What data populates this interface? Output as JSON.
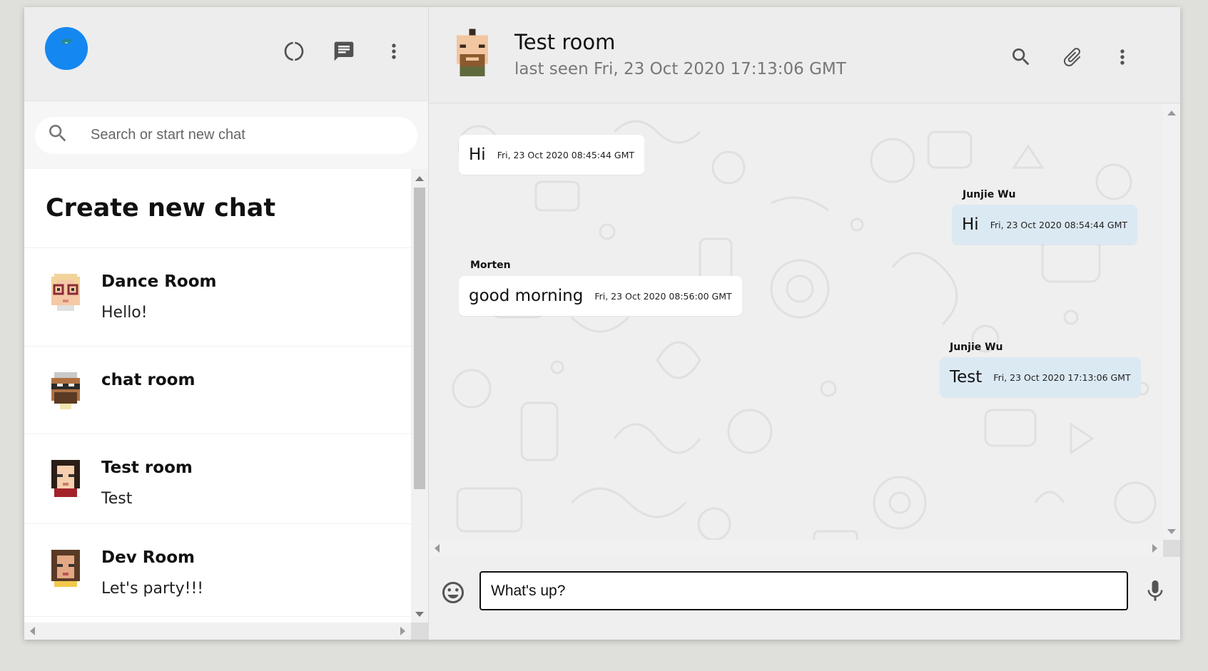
{
  "sidebar": {
    "search_placeholder": "Search or start new chat",
    "create_new_chat": "Create new chat",
    "chats": [
      {
        "name": "Dance Room",
        "last_message": "Hello!",
        "avatar": "pixel-avatar-glasses-blonde"
      },
      {
        "name": "chat room",
        "last_message": "",
        "avatar": "pixel-avatar-glasses-beard"
      },
      {
        "name": "Test room",
        "last_message": "Test",
        "avatar": "pixel-avatar-dark-hair"
      },
      {
        "name": "Dev Room",
        "last_message": "Let's party!!!",
        "avatar": "pixel-avatar-curly-hair"
      }
    ]
  },
  "chat": {
    "title": "Test room",
    "subtitle": "last seen Fri, 23 Oct 2020 17:13:06 GMT",
    "messages": [
      {
        "direction": "in",
        "sender": "",
        "text": "Hi",
        "time": "Fri, 23 Oct 2020 08:45:44 GMT"
      },
      {
        "direction": "out",
        "sender": "Junjie Wu",
        "text": "Hi",
        "time": "Fri, 23 Oct 2020 08:54:44 GMT"
      },
      {
        "direction": "in",
        "sender": "Morten",
        "text": "good morning",
        "time": "Fri, 23 Oct 2020 08:56:00 GMT"
      },
      {
        "direction": "out",
        "sender": "Junjie Wu",
        "text": "Test",
        "time": "Fri, 23 Oct 2020 17:13:06 GMT"
      }
    ],
    "composer_value": "What's up?"
  },
  "colors": {
    "app_background": "#ededed",
    "outgoing_bubble": "#dbe9f3",
    "incoming_bubble": "#ffffff",
    "profile_avatar": "#1587f0"
  },
  "icons": {
    "status": "status-ring-icon",
    "new_chat": "message-icon",
    "menu": "more-vertical-icon",
    "search": "search-icon",
    "attach": "paperclip-icon",
    "emoji": "emoji-icon",
    "mic": "microphone-icon"
  }
}
